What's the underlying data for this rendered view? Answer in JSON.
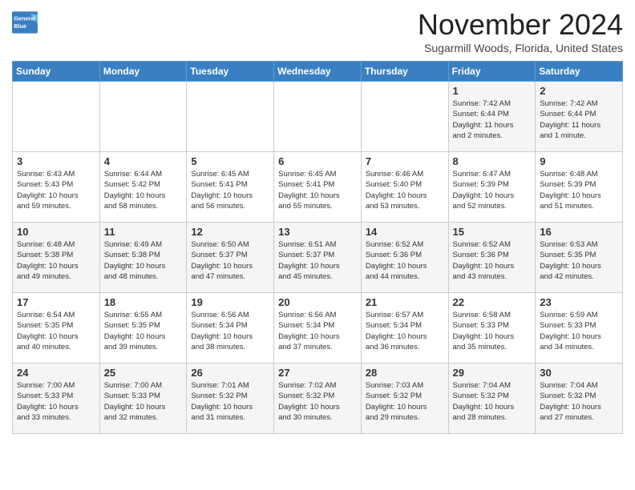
{
  "header": {
    "logo_line1": "General",
    "logo_line2": "Blue",
    "month_title": "November 2024",
    "subtitle": "Sugarmill Woods, Florida, United States"
  },
  "days_of_week": [
    "Sunday",
    "Monday",
    "Tuesday",
    "Wednesday",
    "Thursday",
    "Friday",
    "Saturday"
  ],
  "weeks": [
    [
      {
        "day": "",
        "info": ""
      },
      {
        "day": "",
        "info": ""
      },
      {
        "day": "",
        "info": ""
      },
      {
        "day": "",
        "info": ""
      },
      {
        "day": "",
        "info": ""
      },
      {
        "day": "1",
        "info": "Sunrise: 7:42 AM\nSunset: 6:44 PM\nDaylight: 11 hours\nand 2 minutes."
      },
      {
        "day": "2",
        "info": "Sunrise: 7:42 AM\nSunset: 6:44 PM\nDaylight: 11 hours\nand 1 minute."
      }
    ],
    [
      {
        "day": "3",
        "info": "Sunrise: 6:43 AM\nSunset: 5:43 PM\nDaylight: 10 hours\nand 59 minutes."
      },
      {
        "day": "4",
        "info": "Sunrise: 6:44 AM\nSunset: 5:42 PM\nDaylight: 10 hours\nand 58 minutes."
      },
      {
        "day": "5",
        "info": "Sunrise: 6:45 AM\nSunset: 5:41 PM\nDaylight: 10 hours\nand 56 minutes."
      },
      {
        "day": "6",
        "info": "Sunrise: 6:45 AM\nSunset: 5:41 PM\nDaylight: 10 hours\nand 55 minutes."
      },
      {
        "day": "7",
        "info": "Sunrise: 6:46 AM\nSunset: 5:40 PM\nDaylight: 10 hours\nand 53 minutes."
      },
      {
        "day": "8",
        "info": "Sunrise: 6:47 AM\nSunset: 5:39 PM\nDaylight: 10 hours\nand 52 minutes."
      },
      {
        "day": "9",
        "info": "Sunrise: 6:48 AM\nSunset: 5:39 PM\nDaylight: 10 hours\nand 51 minutes."
      }
    ],
    [
      {
        "day": "10",
        "info": "Sunrise: 6:48 AM\nSunset: 5:38 PM\nDaylight: 10 hours\nand 49 minutes."
      },
      {
        "day": "11",
        "info": "Sunrise: 6:49 AM\nSunset: 5:38 PM\nDaylight: 10 hours\nand 48 minutes."
      },
      {
        "day": "12",
        "info": "Sunrise: 6:50 AM\nSunset: 5:37 PM\nDaylight: 10 hours\nand 47 minutes."
      },
      {
        "day": "13",
        "info": "Sunrise: 6:51 AM\nSunset: 5:37 PM\nDaylight: 10 hours\nand 45 minutes."
      },
      {
        "day": "14",
        "info": "Sunrise: 6:52 AM\nSunset: 5:36 PM\nDaylight: 10 hours\nand 44 minutes."
      },
      {
        "day": "15",
        "info": "Sunrise: 6:52 AM\nSunset: 5:36 PM\nDaylight: 10 hours\nand 43 minutes."
      },
      {
        "day": "16",
        "info": "Sunrise: 6:53 AM\nSunset: 5:35 PM\nDaylight: 10 hours\nand 42 minutes."
      }
    ],
    [
      {
        "day": "17",
        "info": "Sunrise: 6:54 AM\nSunset: 5:35 PM\nDaylight: 10 hours\nand 40 minutes."
      },
      {
        "day": "18",
        "info": "Sunrise: 6:55 AM\nSunset: 5:35 PM\nDaylight: 10 hours\nand 39 minutes."
      },
      {
        "day": "19",
        "info": "Sunrise: 6:56 AM\nSunset: 5:34 PM\nDaylight: 10 hours\nand 38 minutes."
      },
      {
        "day": "20",
        "info": "Sunrise: 6:56 AM\nSunset: 5:34 PM\nDaylight: 10 hours\nand 37 minutes."
      },
      {
        "day": "21",
        "info": "Sunrise: 6:57 AM\nSunset: 5:34 PM\nDaylight: 10 hours\nand 36 minutes."
      },
      {
        "day": "22",
        "info": "Sunrise: 6:58 AM\nSunset: 5:33 PM\nDaylight: 10 hours\nand 35 minutes."
      },
      {
        "day": "23",
        "info": "Sunrise: 6:59 AM\nSunset: 5:33 PM\nDaylight: 10 hours\nand 34 minutes."
      }
    ],
    [
      {
        "day": "24",
        "info": "Sunrise: 7:00 AM\nSunset: 5:33 PM\nDaylight: 10 hours\nand 33 minutes."
      },
      {
        "day": "25",
        "info": "Sunrise: 7:00 AM\nSunset: 5:33 PM\nDaylight: 10 hours\nand 32 minutes."
      },
      {
        "day": "26",
        "info": "Sunrise: 7:01 AM\nSunset: 5:32 PM\nDaylight: 10 hours\nand 31 minutes."
      },
      {
        "day": "27",
        "info": "Sunrise: 7:02 AM\nSunset: 5:32 PM\nDaylight: 10 hours\nand 30 minutes."
      },
      {
        "day": "28",
        "info": "Sunrise: 7:03 AM\nSunset: 5:32 PM\nDaylight: 10 hours\nand 29 minutes."
      },
      {
        "day": "29",
        "info": "Sunrise: 7:04 AM\nSunset: 5:32 PM\nDaylight: 10 hours\nand 28 minutes."
      },
      {
        "day": "30",
        "info": "Sunrise: 7:04 AM\nSunset: 5:32 PM\nDaylight: 10 hours\nand 27 minutes."
      }
    ]
  ]
}
